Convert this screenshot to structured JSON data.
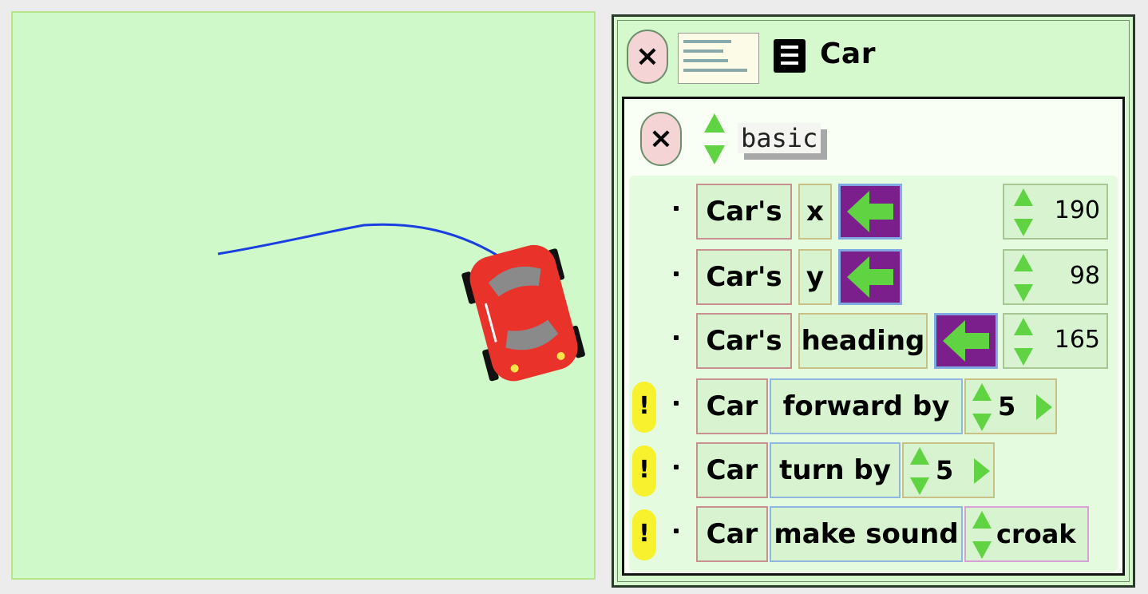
{
  "viewer": {
    "title": "Car",
    "category": "basic",
    "rows": [
      {
        "object": "Car's",
        "property": "x",
        "value": "190"
      },
      {
        "object": "Car's",
        "property": "y",
        "value": "98"
      },
      {
        "object": "Car's",
        "property": "heading",
        "value": "165"
      }
    ],
    "commands": [
      {
        "alert": "!",
        "object": "Car",
        "command": "forward by",
        "value": "5"
      },
      {
        "alert": "!",
        "object": "Car",
        "command": "turn by",
        "value": "5"
      },
      {
        "alert": "!",
        "object": "Car",
        "command": "make sound",
        "value": "croak"
      }
    ]
  },
  "colors": {
    "playfield": "#cff9c8",
    "trail": "#1a3fe0",
    "car_body": "#e8322a",
    "assign_tile": "#7b1f8c",
    "arrow_green": "#5fd342",
    "alert_yellow": "#f7f12e"
  },
  "icons": [
    "close-icon",
    "menu-icon",
    "up-down-arrows-icon",
    "assign-arrow-icon",
    "play-triangle-icon"
  ]
}
